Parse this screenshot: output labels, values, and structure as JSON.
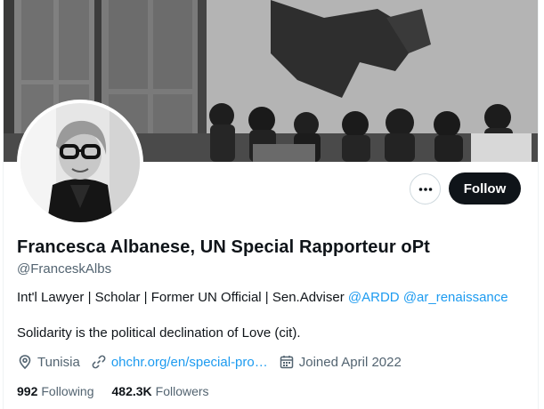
{
  "profile": {
    "display_name": "Francesca Albanese, UN Special Rapporteur oPt",
    "handle": "@FranceskAlbs",
    "bio": {
      "text": "Int'l Lawyer | Scholar | Former UN Official | Sen.Adviser ",
      "mention_1": "@ARDD",
      "mention_2": "@ar_renaissance"
    },
    "quote": "Solidarity is the political declination of Love (cit).",
    "location": "Tunisia",
    "website": "ohchr.org/en/special-pro…",
    "joined": "Joined April 2022",
    "stats": {
      "following_count": "992",
      "following_label": "Following",
      "followers_count": "482.3K",
      "followers_label": "Followers"
    }
  },
  "actions": {
    "follow_label": "Follow",
    "more_icon": "more-horizontal-icon"
  },
  "icons": {
    "location": "location-pin-icon",
    "website": "link-icon",
    "joined": "calendar-icon"
  },
  "colors": {
    "accent": "#1d9bf0",
    "text": "#0f1419",
    "secondary": "#536471",
    "button_bg": "#0f1419"
  }
}
